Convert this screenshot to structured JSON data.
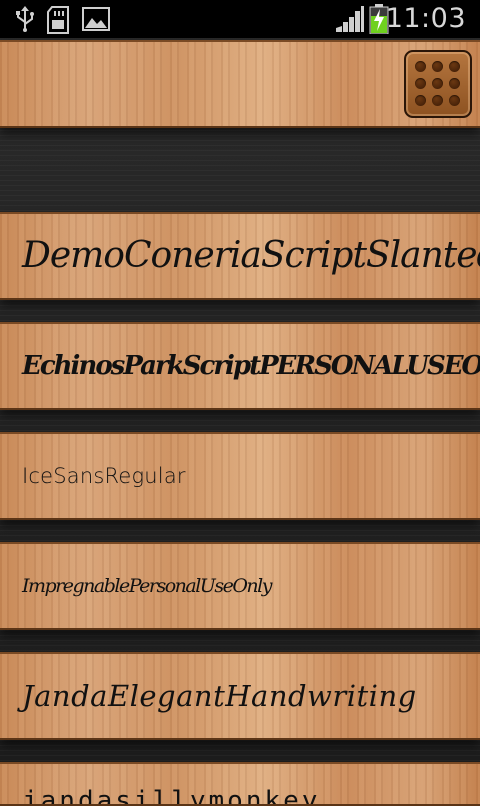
{
  "status_bar": {
    "time": "11:03",
    "icons": [
      "usb-icon",
      "sd-card-icon",
      "image-icon",
      "signal-icon",
      "battery-charging-icon"
    ]
  },
  "header": {
    "menu_icon": "grid-menu-icon"
  },
  "font_list": [
    {
      "label": "DemoConeriaScriptSlanted"
    },
    {
      "label": "EchinosParkScriptPERSONALUSEONLY"
    },
    {
      "label": "IceSansRegular"
    },
    {
      "label": "ImpregnablePersonalUseOnly"
    },
    {
      "label": "JandaElegantHandwriting"
    },
    {
      "label": "jandasillymonkey"
    }
  ],
  "colors": {
    "wood": "#d9a57a",
    "background": "#1f1f1f",
    "status_bar": "#000000",
    "battery_green": "#6fd11f"
  }
}
